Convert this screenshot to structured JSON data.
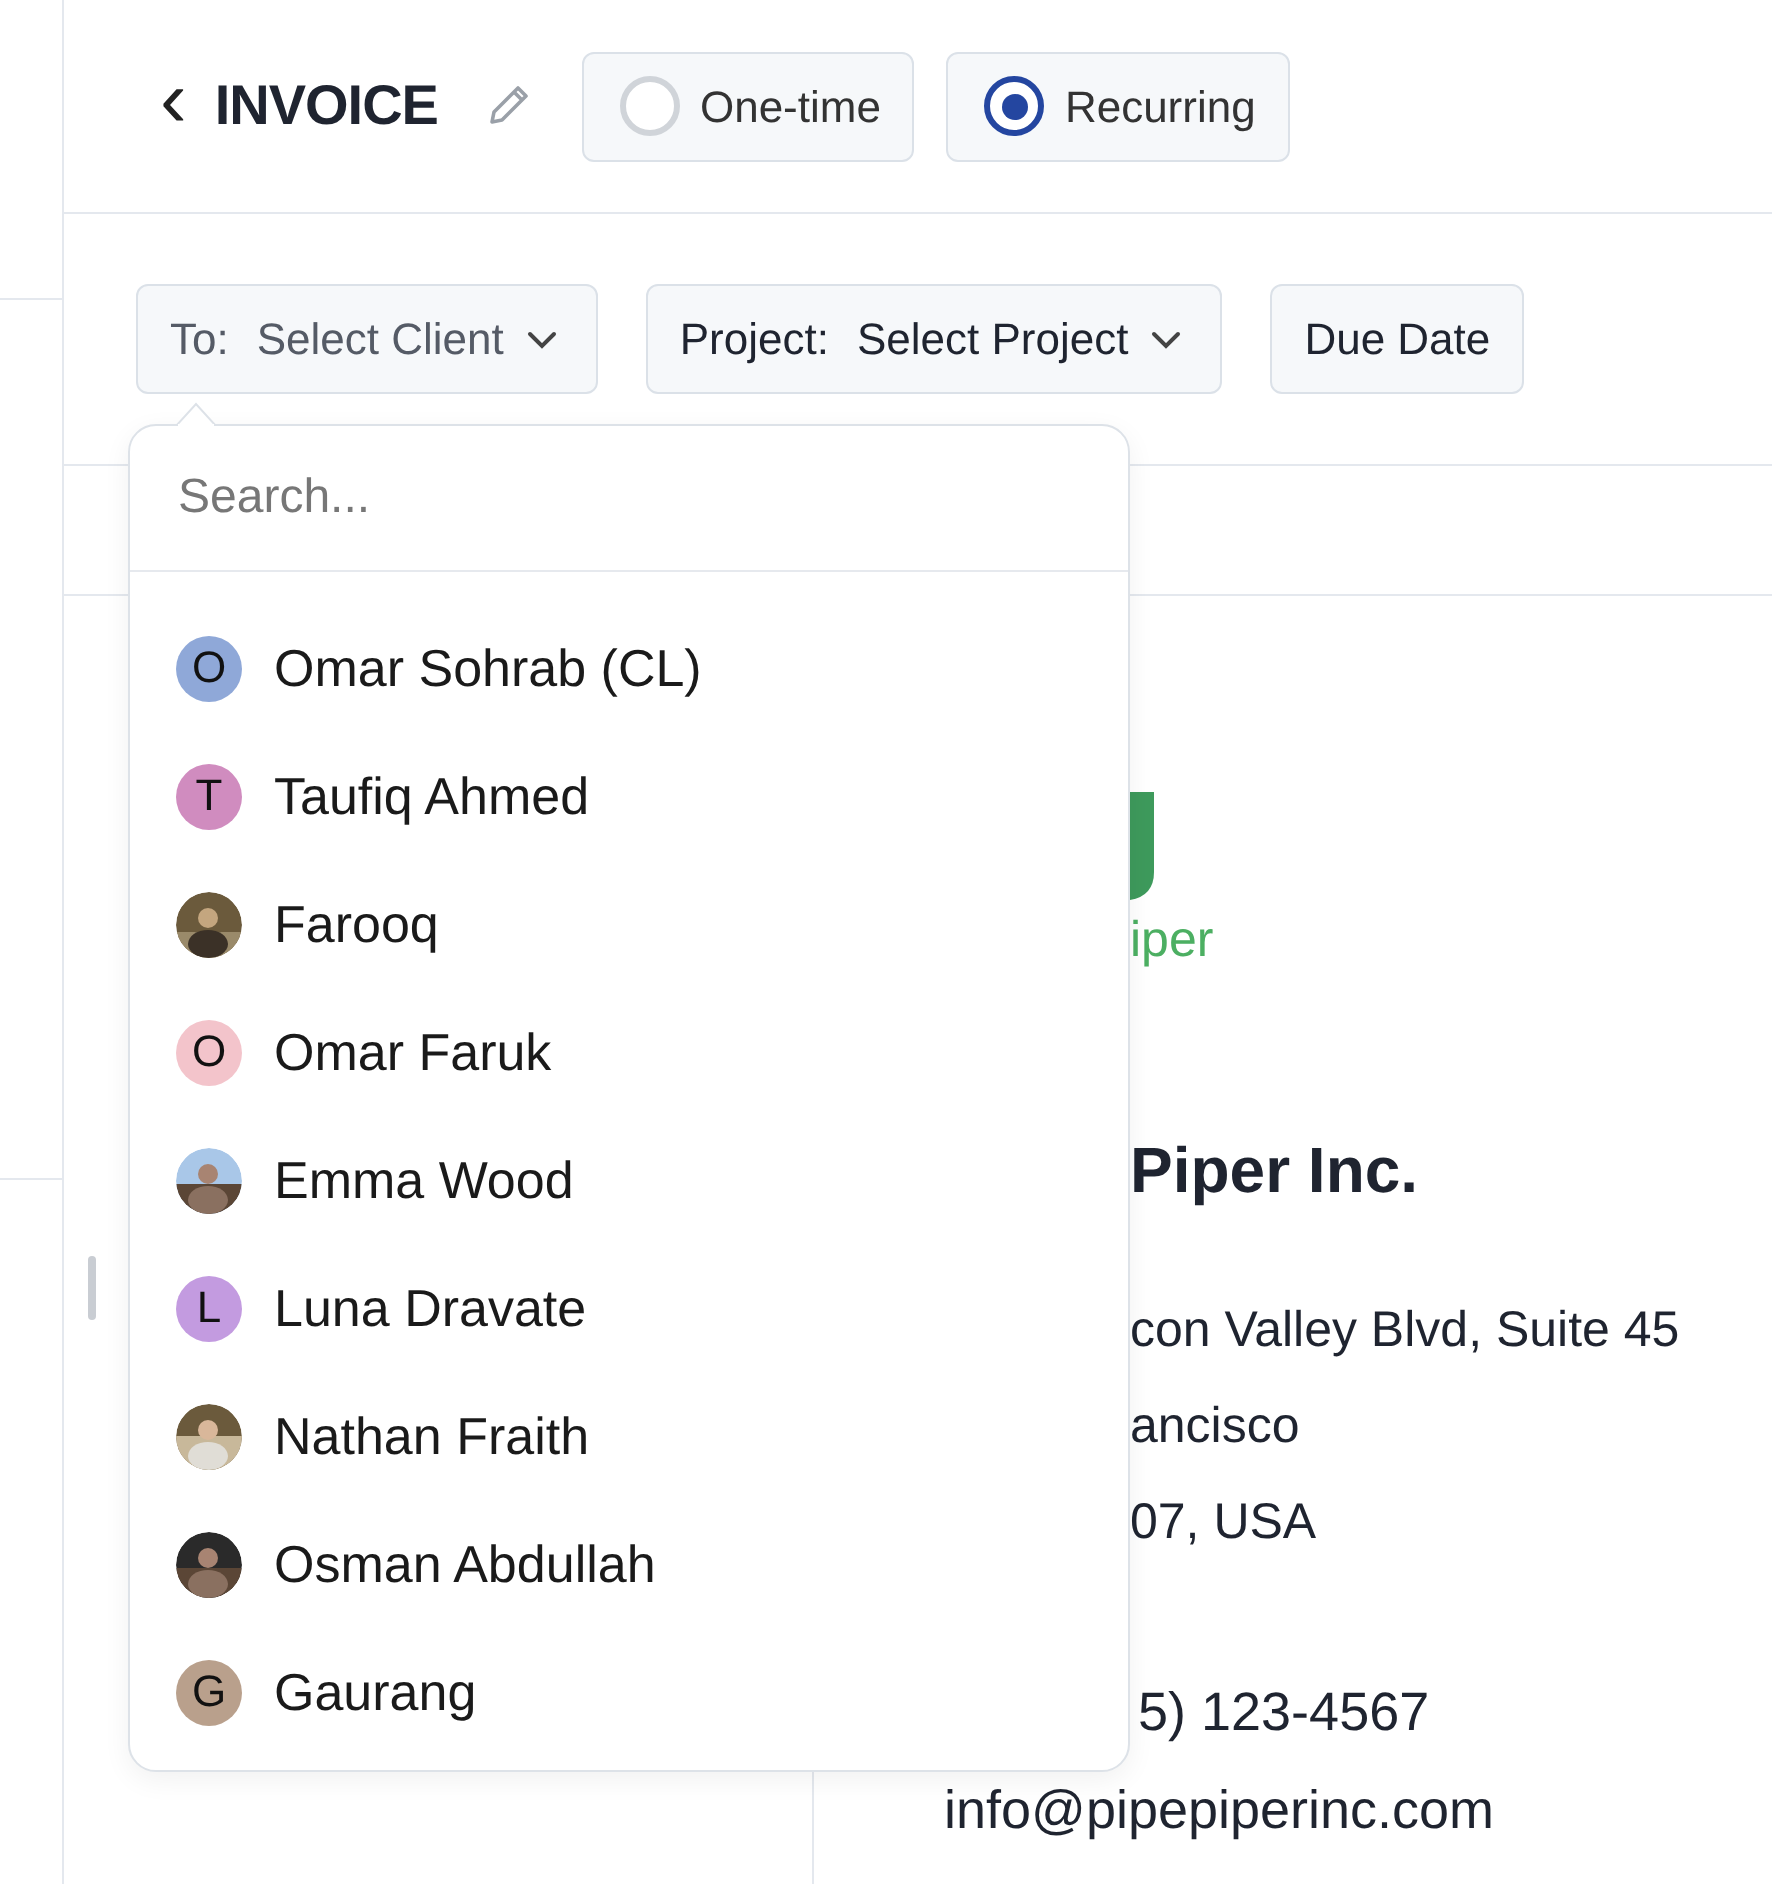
{
  "header": {
    "back": "‹",
    "title": "INVOICE",
    "types": [
      {
        "label": "One-time",
        "selected": false
      },
      {
        "label": "Recurring",
        "selected": true
      }
    ]
  },
  "filters": [
    {
      "prefix": "To:",
      "value": "Select Client",
      "kind": "dropdown",
      "muted": true
    },
    {
      "prefix": "Project:",
      "value": "Select Project",
      "kind": "dropdown",
      "muted": false
    },
    {
      "value": "Due Date",
      "kind": "plain",
      "muted": false
    }
  ],
  "client_dropdown": {
    "placeholder": "Search...",
    "clients": [
      {
        "name": "Omar Sohrab (CL)",
        "kind": "letter",
        "initial": "O",
        "color": "#8fa8d8"
      },
      {
        "name": "Taufiq Ahmed",
        "kind": "letter",
        "initial": "T",
        "color": "#d08cbf"
      },
      {
        "name": "Farooq"
      },
      {
        "name": "Omar Faruk",
        "kind": "letter",
        "initial": "O",
        "color": "#f3c4cb"
      },
      {
        "name": "Emma Wood"
      },
      {
        "name": "Luna Dravate",
        "kind": "letter",
        "initial": "L",
        "color": "#c39be0"
      },
      {
        "name": "Nathan Fraith"
      },
      {
        "name": "Osman Abdullah"
      },
      {
        "name": "Gaurang",
        "kind": "letter",
        "initial": "G",
        "color": "#b9a08c"
      }
    ]
  },
  "invoice_preview": {
    "logo_text": "iper",
    "company": "Piper Inc.",
    "address_lines": [
      "con Valley Blvd, Suite 45",
      "ancisco",
      "07, USA"
    ],
    "phone": "5) 123-4567",
    "email": "info@pipepiperinc.com"
  }
}
